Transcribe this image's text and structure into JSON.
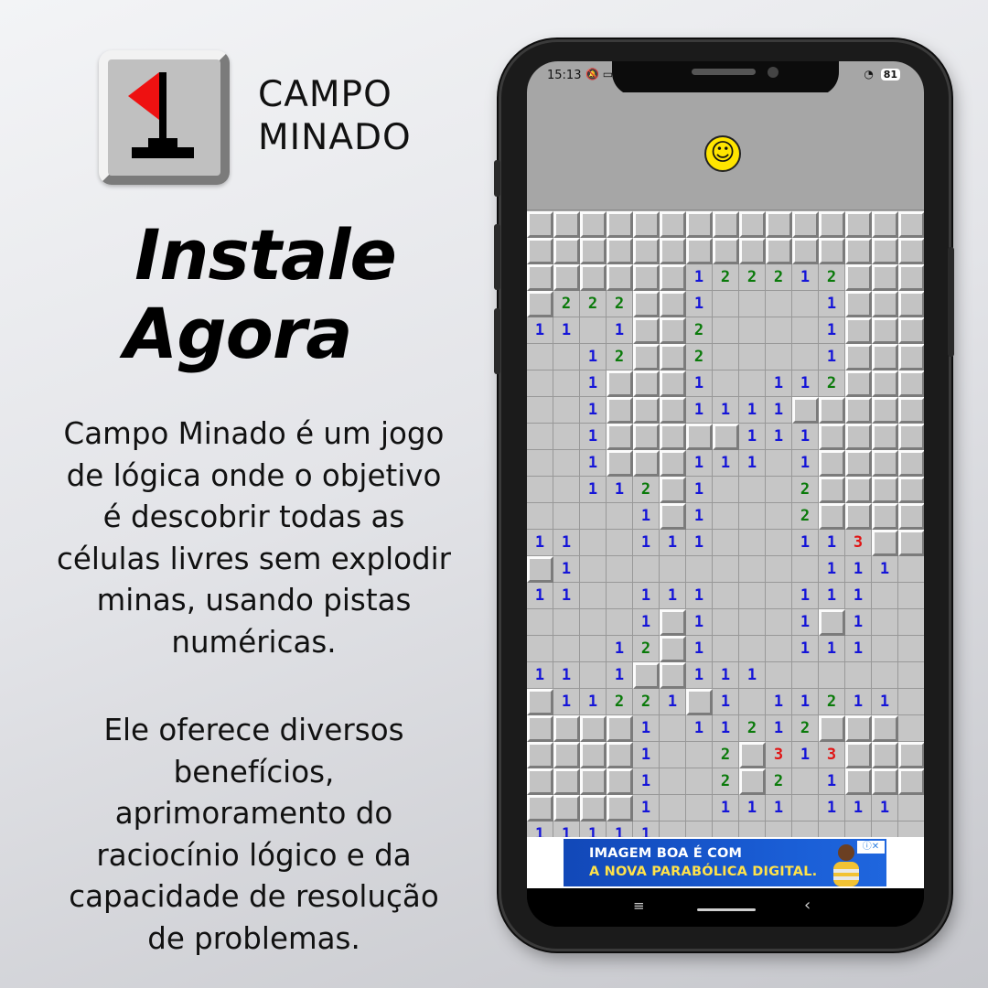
{
  "brand": {
    "line1": "CAMPO",
    "line2": "MINADO"
  },
  "headline": {
    "line1": "Instale",
    "line2": "Agora"
  },
  "description": [
    "Campo Minado é um jogo",
    "de lógica onde o objetivo",
    "é descobrir todas as",
    "células livres sem explodir",
    "minas, usando pistas",
    "numéricas."
  ],
  "benefits": [
    "Ele oferece diversos",
    "benefícios,",
    "aprimoramento do",
    "raciocínio lógico e da",
    "capacidade de resolução",
    "de problemas."
  ],
  "status_bar": {
    "time": "15:13",
    "battery": "81"
  },
  "game": {
    "face_icon": "smiley-face-icon",
    "colors": {
      "1": "#1414d8",
      "2": "#0a7a0a",
      "3": "#e01414"
    },
    "legend": "# = covered cell, . = empty revealed cell, digits = adjacent mine count",
    "board": [
      "###############",
      "###############",
      "######122212###",
      "#222##1....1###",
      "11.1##2....1###",
      "..12##2....1###",
      "..1###1..112###",
      "..1###1111#####",
      "..1#####111####",
      "..1###111.1####",
      "..112#1...2####",
      "....1#1...2####",
      "11..111...113##",
      "#1.........111.",
      "11..111...111..",
      "....1#1...1#1..",
      "...12#1...111..",
      "11.1##111......",
      "#11221#1.11211.",
      "####1.11212###.",
      "####1..2#313###",
      "####1..2#2.1###",
      "####1..111.111.",
      "11111.........."
    ]
  },
  "ad": {
    "line1": "IMAGEM BOA É COM",
    "line2": "A NOVA PARABÓLICA DIGITAL.",
    "close_label": "ⓘ✕"
  },
  "navigation": {
    "menu_icon": "≡",
    "back_icon": "‹"
  }
}
